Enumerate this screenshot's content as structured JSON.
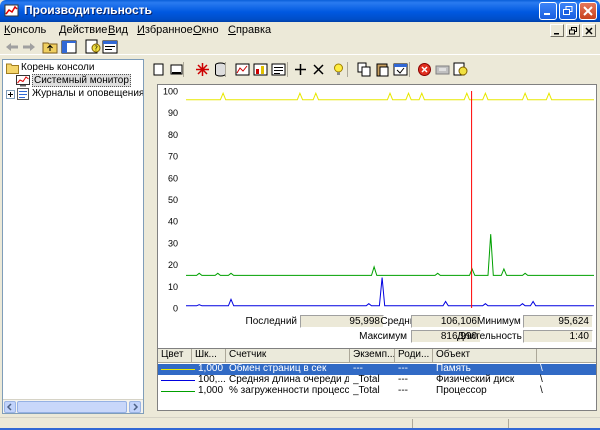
{
  "window": {
    "title": "Производительность",
    "app_icon": "performance-icon"
  },
  "titlebar_buttons": [
    "minimize-icon",
    "restore-icon",
    "close-icon"
  ],
  "menu": [
    "Консоль",
    "Действие",
    "Вид",
    "Избранное",
    "Окно",
    "Справка"
  ],
  "toolbar_icons": [
    "back-arrow-icon",
    "forward-arrow-icon",
    "up-folder-icon",
    "show-hide-tree-icon",
    "help-icon",
    "properties-icon"
  ],
  "tree": {
    "root": "Корень консоли",
    "items": [
      {
        "label": "Системный монитор",
        "selected": true
      },
      {
        "label": "Журналы и оповещения производительности",
        "expandable": true
      }
    ]
  },
  "graph_toolbar_icons": [
    "new-counter-set-icon",
    "clear-display-icon",
    "view-current-activity-icon",
    "view-log-data-icon",
    "view-graph-icon",
    "view-histogram-icon",
    "view-report-icon",
    "add-icon",
    "delete-icon",
    "highlight-icon",
    "copy-properties-icon",
    "paste-counter-list-icon",
    "properties-icon",
    "freeze-display-icon",
    "update-data-icon",
    "help-icon"
  ],
  "graph": {
    "y_ticks": [
      "100",
      "90",
      "80",
      "70",
      "60",
      "50",
      "40",
      "30",
      "20",
      "10",
      "0"
    ],
    "time_bar_position": 0.7,
    "colors": {
      "yellow": "#e8e800",
      "green": "#00a000",
      "blue": "#0000e0",
      "time_bar": "#ff0000",
      "grid": "#c0c0c0"
    }
  },
  "chart_data": {
    "type": "line",
    "ylim": [
      0,
      100
    ],
    "series": [
      {
        "name": "Обмен страниц в сек",
        "color": "#e8e800",
        "values": [
          96,
          96,
          96,
          96,
          96,
          96,
          96,
          96,
          96,
          96,
          96,
          96,
          96,
          96,
          99,
          96,
          96,
          96,
          96,
          96,
          96,
          96,
          96,
          96,
          96,
          96,
          96,
          96,
          96,
          96,
          96,
          96,
          96,
          96,
          96,
          96,
          96,
          96,
          96,
          96,
          96,
          96,
          96,
          99,
          96,
          96,
          96,
          96,
          96,
          99,
          96,
          96,
          96,
          96,
          96,
          96,
          96,
          96,
          96,
          96,
          96,
          96,
          96,
          96,
          96,
          96,
          96,
          96,
          96,
          96,
          96,
          96,
          96,
          96,
          96,
          96,
          96,
          99,
          96,
          96,
          96,
          96,
          96,
          96,
          99,
          96,
          96,
          96,
          96,
          99,
          96,
          96,
          96,
          96,
          96,
          96,
          96,
          96,
          96,
          96,
          96,
          96,
          96,
          96,
          96,
          96,
          99,
          96,
          96,
          96,
          96,
          96,
          96,
          99,
          96,
          96,
          96,
          96,
          96,
          96,
          96,
          96,
          96,
          96,
          96,
          96,
          96,
          96,
          99,
          96,
          96,
          96,
          96,
          96,
          96,
          96,
          96,
          99,
          96,
          96,
          96,
          96,
          96,
          96,
          96,
          96,
          96,
          96,
          96,
          96,
          96,
          96,
          96,
          96,
          96
        ]
      },
      {
        "name": "Средняя длина очереди диска",
        "color": "#0000e0",
        "values": [
          1,
          1,
          1,
          1,
          1,
          1.5,
          1,
          1,
          1,
          1,
          1,
          1,
          1,
          1,
          1,
          1,
          1,
          4,
          1,
          1,
          1,
          1,
          1,
          1,
          1,
          1,
          1,
          1,
          1,
          1,
          1,
          1,
          1,
          1,
          1,
          1,
          1,
          1,
          1,
          1,
          1,
          1,
          1,
          1,
          1,
          1,
          1,
          1,
          1,
          1,
          1,
          1,
          1,
          1,
          1,
          1,
          1,
          1,
          1,
          1,
          1,
          1,
          1,
          1,
          1,
          1,
          1,
          1,
          1,
          2,
          1,
          1,
          1,
          1,
          14,
          1,
          1,
          1,
          1,
          1,
          1,
          1,
          1,
          1,
          1,
          1,
          1,
          1,
          1,
          1,
          1,
          1,
          1,
          1,
          1,
          1,
          1,
          1,
          3,
          1,
          1,
          1,
          1,
          1,
          1,
          1,
          1,
          1,
          1,
          1,
          1,
          1,
          1,
          2,
          1,
          1,
          1,
          1,
          1,
          1,
          1,
          1,
          1,
          1,
          1,
          1,
          1,
          2,
          1,
          1,
          1,
          3,
          1,
          1,
          1,
          1,
          1,
          1,
          1,
          1,
          1,
          1,
          1,
          1,
          1,
          1,
          1,
          1,
          1,
          1,
          1,
          1,
          1,
          1,
          1
        ]
      },
      {
        "name": "% загруженности процессора",
        "color": "#00a000",
        "values": [
          15,
          15,
          15,
          15,
          15,
          16,
          15,
          15,
          15,
          15,
          15,
          15,
          16,
          15,
          15,
          15,
          15,
          16,
          15,
          15,
          15,
          15,
          15,
          15,
          15,
          15,
          15,
          15,
          15,
          15,
          15,
          15,
          15,
          15,
          15,
          15,
          15,
          15,
          15,
          15,
          15,
          15,
          15,
          15,
          15,
          15,
          15,
          15,
          15,
          15,
          15,
          15,
          15,
          15,
          15,
          15,
          15,
          15,
          15,
          15,
          15,
          15,
          15,
          15,
          15,
          15,
          15,
          15,
          15,
          15,
          15,
          19,
          15,
          15,
          15,
          15,
          15,
          15,
          15,
          15,
          15,
          15,
          15,
          15,
          15,
          15,
          15,
          15,
          15,
          15,
          15,
          15,
          15,
          15,
          15,
          16,
          15,
          15,
          15,
          15,
          15,
          15,
          15,
          15,
          15,
          15,
          15,
          15,
          18,
          15,
          15,
          15,
          15,
          15,
          15,
          34,
          15,
          15,
          15,
          15,
          18,
          15,
          15,
          15,
          15,
          15,
          15,
          15,
          16,
          15,
          15,
          15,
          15,
          15,
          15,
          15,
          15,
          15,
          15,
          15,
          15,
          15,
          15,
          15,
          15,
          15,
          15,
          15,
          15,
          15,
          15,
          15,
          15,
          15,
          15
        ]
      }
    ]
  },
  "stats": {
    "last_label": "Последний",
    "last_value": "95,998",
    "avg_label": "Средний",
    "avg_value": "106,106",
    "min_label": "Минимум",
    "min_value": "95,624",
    "max_label": "Максимум",
    "max_value": "816,990",
    "dur_label": "Длительность",
    "dur_value": "1:40"
  },
  "legend": {
    "columns": [
      "Цвет",
      "Шк...",
      "Счетчик",
      "Экземп...",
      "Роди...",
      "Объект"
    ],
    "rows": [
      {
        "color": "#e8e800",
        "scale": "1,000",
        "counter": "Обмен страниц в сек",
        "instance": "---",
        "parent": "---",
        "object": "Память",
        "computer": "\\",
        "selected": true
      },
      {
        "color": "#0000e0",
        "scale": "100,...",
        "counter": "Средняя длина очереди диска",
        "instance": "_Total",
        "parent": "---",
        "object": "Физический диск",
        "computer": "\\"
      },
      {
        "color": "#00a000",
        "scale": "1,000",
        "counter": "% загруженности процессора",
        "instance": "_Total",
        "parent": "---",
        "object": "Процессор",
        "computer": "\\"
      }
    ]
  }
}
